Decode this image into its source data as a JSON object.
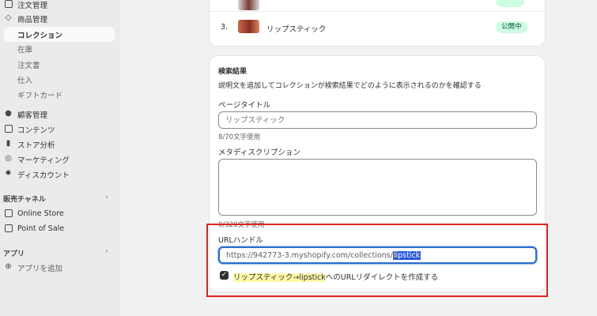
{
  "sidebar": {
    "items": [
      {
        "label": "注文管理",
        "icon": "inbox-icon"
      },
      {
        "label": "商品管理",
        "icon": "tag-icon"
      },
      {
        "label": "コレクション",
        "icon": ""
      },
      {
        "label": "在庫",
        "icon": ""
      },
      {
        "label": "注文書",
        "icon": ""
      },
      {
        "label": "仕入",
        "icon": ""
      },
      {
        "label": "ギフトカード",
        "icon": ""
      },
      {
        "label": "顧客管理",
        "icon": "person-icon"
      },
      {
        "label": "コンテンツ",
        "icon": "image-icon"
      },
      {
        "label": "ストア分析",
        "icon": "bar-chart-icon"
      },
      {
        "label": "マーケティング",
        "icon": "target-icon"
      },
      {
        "label": "ディスカウント",
        "icon": "discount-icon"
      }
    ],
    "sales_channels": {
      "title": "販売チャネル",
      "items": [
        {
          "label": "Online Store",
          "icon": "store-icon"
        },
        {
          "label": "Point of Sale",
          "icon": "pos-icon"
        }
      ]
    },
    "apps": {
      "title": "アプリ",
      "add_label": "アプリを追加"
    }
  },
  "products": {
    "rows": [
      {
        "num": "3.",
        "name": "リップスティック",
        "status": "公開中"
      }
    ],
    "status_color": "#cdfee1"
  },
  "seo": {
    "title": "検索結果",
    "description": "説明文を追加してコレクションが検索結果でどのように表示されるのかを確認する",
    "page_title_label": "ページタイトル",
    "page_title_placeholder": "リップスティック",
    "page_title_count": "8/70文字使用",
    "meta_label": "メタディスクリプション",
    "meta_value": "",
    "meta_count": "0/320文字使用",
    "url_label": "URLハンドル",
    "url_prefix": "https://942773-3.myshopify.com/collections/",
    "url_handle": "lipstick",
    "redirect_from": "リップスティック",
    "redirect_arrow": "→",
    "redirect_to": "lipstick",
    "redirect_suffix": "へのURLリダイレクトを作成する",
    "redirect_checked": true
  },
  "colors": {
    "highlight_border": "#e0221f",
    "selection": "#2a5bd7",
    "focus": "#2c6ecb"
  }
}
